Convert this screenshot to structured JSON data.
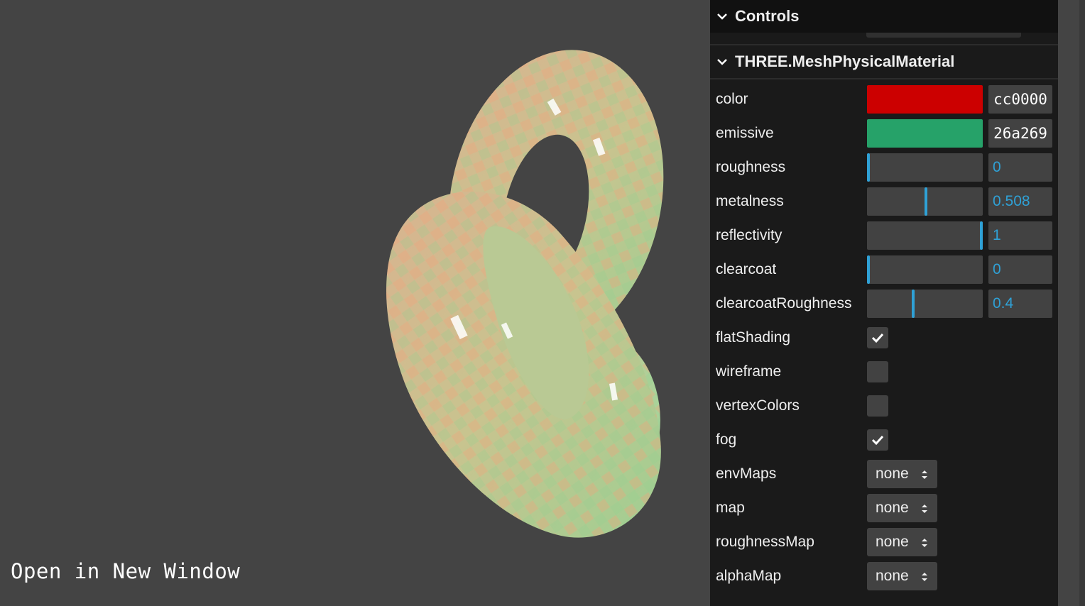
{
  "viewport": {
    "open_link": "Open in New Window"
  },
  "panel": {
    "controls_title": "Controls",
    "material_title": "THREE.MeshPhysicalMaterial",
    "color": {
      "label": "color",
      "value": "cc0000",
      "swatch": "#cc0000"
    },
    "emissive": {
      "label": "emissive",
      "value": "26a269",
      "swatch": "#26a269"
    },
    "roughness": {
      "label": "roughness",
      "value": "0",
      "fraction": 0
    },
    "metalness": {
      "label": "metalness",
      "value": "0.508",
      "fraction": 0.508
    },
    "reflectivity": {
      "label": "reflectivity",
      "value": "1",
      "fraction": 1
    },
    "clearcoat": {
      "label": "clearcoat",
      "value": "0",
      "fraction": 0
    },
    "clearcoatRoughness": {
      "label": "clearcoatRoughness",
      "value": "0.4",
      "fraction": 0.4
    },
    "flatShading": {
      "label": "flatShading",
      "checked": true
    },
    "wireframe": {
      "label": "wireframe",
      "checked": false
    },
    "vertexColors": {
      "label": "vertexColors",
      "checked": false
    },
    "fog": {
      "label": "fog",
      "checked": true
    },
    "envMaps": {
      "label": "envMaps",
      "value": "none"
    },
    "map": {
      "label": "map",
      "value": "none"
    },
    "roughnessMap": {
      "label": "roughnessMap",
      "value": "none"
    },
    "alphaMap": {
      "label": "alphaMap",
      "value": "none"
    }
  },
  "colors": {
    "slider_accent": "#2fa1d6",
    "panel_bg": "#1a1a1a",
    "viewport_bg": "#444444"
  }
}
